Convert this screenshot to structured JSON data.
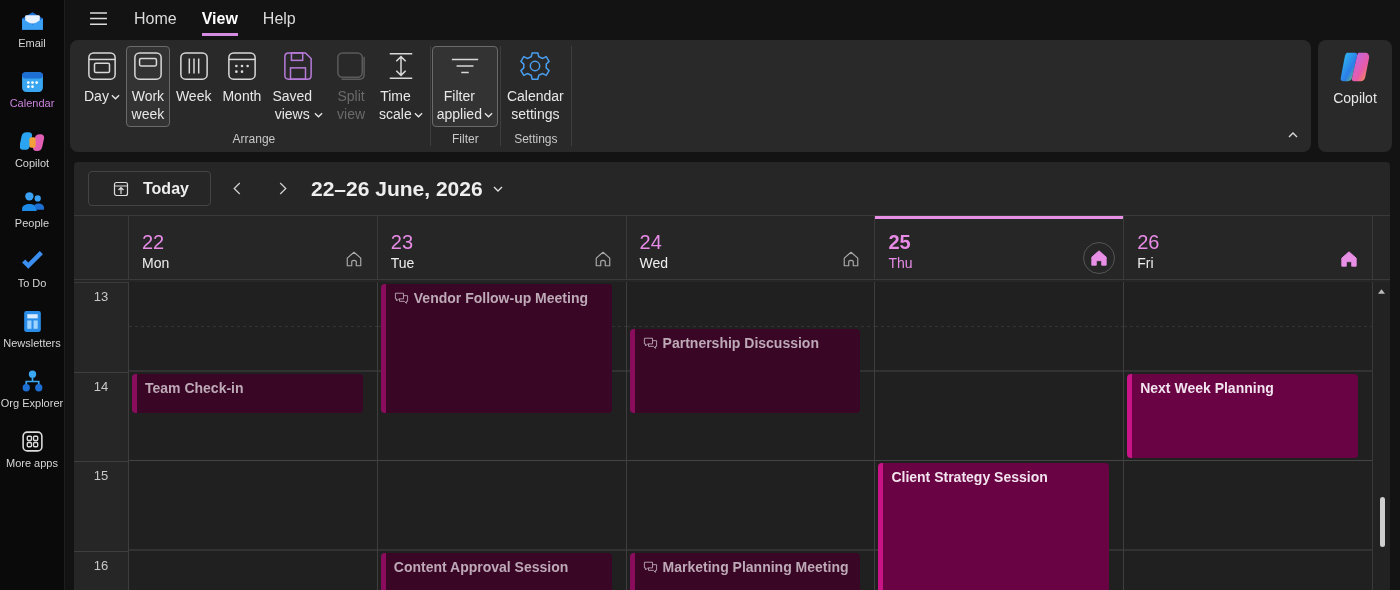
{
  "rail": [
    {
      "label": "Email",
      "selected": false
    },
    {
      "label": "Calendar",
      "selected": true
    },
    {
      "label": "Copilot",
      "selected": false
    },
    {
      "label": "People",
      "selected": false
    },
    {
      "label": "To Do",
      "selected": false
    },
    {
      "label": "Newsletters",
      "selected": false
    },
    {
      "label": "Org Explorer",
      "selected": false
    },
    {
      "label": "More apps",
      "selected": false
    }
  ],
  "menu_tabs": [
    {
      "label": "Home",
      "selected": false
    },
    {
      "label": "View",
      "selected": true
    },
    {
      "label": "Help",
      "selected": false
    }
  ],
  "ribbon": {
    "groups": [
      {
        "label": "Arrange",
        "buttons": [
          {
            "label": "Day",
            "dropdown": true,
            "selected": false,
            "disabled": false
          },
          {
            "label": "Work week",
            "dropdown": false,
            "selected": true,
            "disabled": false
          },
          {
            "label": "Week",
            "dropdown": false,
            "selected": false,
            "disabled": false
          },
          {
            "label": "Month",
            "dropdown": false,
            "selected": false,
            "disabled": false
          },
          {
            "label": "Saved views",
            "dropdown": true,
            "selected": false,
            "disabled": false
          },
          {
            "label": "Split view",
            "dropdown": false,
            "selected": false,
            "disabled": true
          },
          {
            "label": "Time scale",
            "dropdown": true,
            "selected": false,
            "disabled": false
          }
        ]
      },
      {
        "label": "Filter",
        "buttons": [
          {
            "label": "Filter applied",
            "dropdown": true,
            "selected": true,
            "disabled": false
          }
        ]
      },
      {
        "label": "Settings",
        "buttons": [
          {
            "label": "Calendar settings",
            "dropdown": false,
            "selected": false,
            "disabled": false
          }
        ]
      }
    ]
  },
  "copilot": {
    "label": "Copilot"
  },
  "toolbar": {
    "today": "Today",
    "range": "22–26 June, 2026"
  },
  "hours": [
    "13",
    "14",
    "15",
    "16"
  ],
  "days": [
    {
      "date": "22",
      "weekday": "Mon",
      "today": false,
      "home_filled": false,
      "events": [
        {
          "title": "Team Check-in",
          "past": true,
          "chat": false
        }
      ]
    },
    {
      "date": "23",
      "weekday": "Tue",
      "today": false,
      "home_filled": false,
      "events": [
        {
          "title": "Vendor Follow-up Meeting",
          "past": true,
          "chat": true
        },
        {
          "title": "Content Approval Session",
          "past": true,
          "chat": false
        }
      ]
    },
    {
      "date": "24",
      "weekday": "Wed",
      "today": false,
      "home_filled": false,
      "events": [
        {
          "title": "Partnership Discussion",
          "past": true,
          "chat": true
        },
        {
          "title": "Marketing Planning Meeting",
          "past": true,
          "chat": true
        }
      ]
    },
    {
      "date": "25",
      "weekday": "Thu",
      "today": true,
      "home_filled": true,
      "events": [
        {
          "title": "Client Strategy Session",
          "past": false,
          "chat": false
        }
      ]
    },
    {
      "date": "26",
      "weekday": "Fri",
      "today": false,
      "home_filled": true,
      "events": [
        {
          "title": "Next Week Planning",
          "past": false,
          "chat": false
        }
      ]
    }
  ]
}
